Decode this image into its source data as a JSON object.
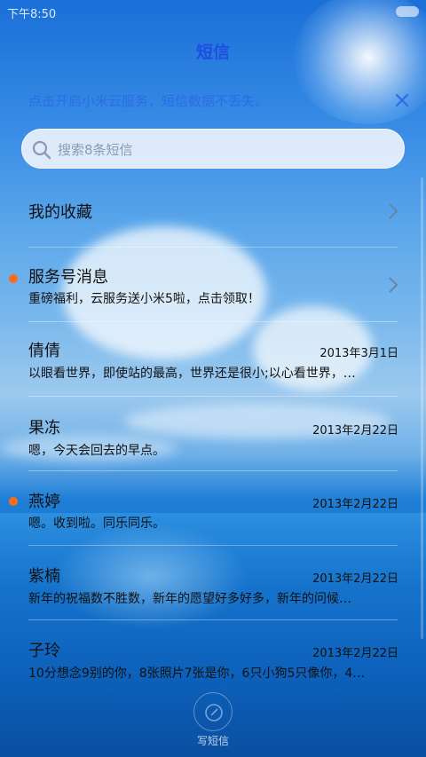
{
  "status_bar": {
    "time": "下午8:50"
  },
  "header": {
    "title": "短信"
  },
  "cloud_banner": {
    "text": "点击开启小米云服务，短信数据不丢失。"
  },
  "search": {
    "placeholder": "搜索8条短信"
  },
  "favorites": {
    "label": "我的收藏"
  },
  "conversations": [
    {
      "name": "服务号消息",
      "preview": "重磅福利，云服务送小米5啦，点击领取！",
      "date": "",
      "unread": true
    },
    {
      "name": "倩倩",
      "preview": "以眼看世界，即使站的最高，世界还是很小;以心看世界，…",
      "date": "2013年3月1日",
      "unread": false
    },
    {
      "name": "果冻",
      "preview": "嗯，今天会回去的早点。",
      "date": "2013年2月22日",
      "unread": false
    },
    {
      "name": "燕婷",
      "preview": "嗯。收到啦。同乐同乐。",
      "date": "2013年2月22日",
      "unread": true
    },
    {
      "name": "紫楠",
      "preview": "新年的祝福数不胜数，新年的愿望好多好多，新年的问候…",
      "date": "2013年2月22日",
      "unread": false
    },
    {
      "name": "子玲",
      "preview": "10分想念9别的你，8张照片7张是你，6只小狗5只像你，4…",
      "date": "2013年2月22日",
      "unread": false
    }
  ],
  "compose": {
    "label": "写短信"
  },
  "colors": {
    "title": "#1f4fe0",
    "banner_text": "#2b6ce8",
    "unread_dot": "#ff6a1a"
  }
}
